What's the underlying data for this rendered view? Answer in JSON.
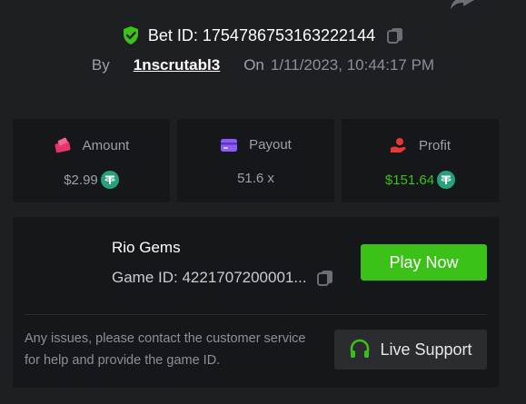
{
  "bet": {
    "id_label": "Bet ID: 1754786753163222144",
    "by_label": "By",
    "user": "1nscrutabl3",
    "on_label": "On",
    "date": "1/11/2023, 10:44:17 PM"
  },
  "stats": [
    {
      "label": "Amount",
      "value": "$2.99",
      "icon": "wallet-icon",
      "currency_icon": "tether-icon"
    },
    {
      "label": "Payout",
      "value": "51.6 x",
      "icon": "card-icon"
    },
    {
      "label": "Profit",
      "value": "$151.64",
      "icon": "hand-coin-icon",
      "currency_icon": "tether-icon"
    }
  ],
  "game": {
    "name": "Rio Gems",
    "id_label": "Game ID: 4221707200001...",
    "play_label": "Play Now",
    "issues_text": "Any issues, please contact the customer service for help and provide the game ID.",
    "support_label": "Live Support"
  },
  "colors": {
    "accent_green": "#3bc117",
    "tether": "#26a17b",
    "amount_icon": "#e8346b",
    "payout_icon": "#8b5cf6",
    "profit_icon": "#e53935"
  }
}
